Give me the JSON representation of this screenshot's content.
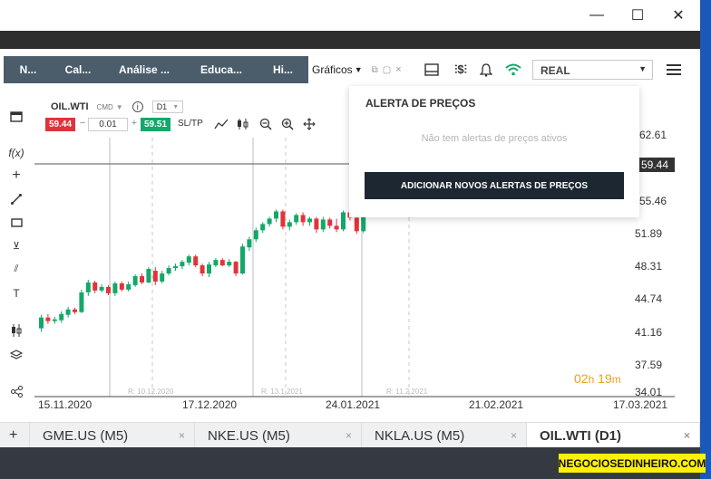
{
  "nav": {
    "tabs": [
      {
        "label": "N..."
      },
      {
        "label": "Cal..."
      },
      {
        "label": "Análise ..."
      },
      {
        "label": "Educa..."
      },
      {
        "label": "Hi..."
      }
    ],
    "graficos_label": "Gráficos",
    "account_selector": "REAL"
  },
  "window": {
    "minimize": "—",
    "maximize": "☐",
    "close": "✕"
  },
  "instrument": {
    "symbol": "OIL.WTI",
    "type": "CMD",
    "timeframe": "D1",
    "sell_price": "59.44",
    "quantity": "0.01",
    "buy_price": "59.51",
    "sltp_label": "SL/TP",
    "minus": "−",
    "plus": "+"
  },
  "price_alerts": {
    "title": "ALERTA DE PREÇOS",
    "empty_text": "Não tem alertas de preços ativos",
    "add_button": "ADICIONAR NOVOS ALERTAS DE PREÇOS"
  },
  "chart_data": {
    "type": "candlestick",
    "symbol": "OIL.WTI",
    "timeframe": "D1",
    "current_price": "59.44",
    "y_ticks": [
      "62.61",
      "55.46",
      "51.89",
      "48.31",
      "44.74",
      "41.16",
      "37.59",
      "34.01"
    ],
    "x_ticks": [
      "15.11.2020",
      "17.12.2020",
      "24.01.2021",
      "21.02.2021",
      "17.03.2021"
    ],
    "rollover_labels": [
      "R: 10.12.2020",
      "R: 13.1.2021",
      "R: 11.2.2021"
    ],
    "candles": [
      [
        41.0,
        42.2,
        40.6,
        42.5,
        "up"
      ],
      [
        42.2,
        41.8,
        41.5,
        42.6,
        "down"
      ],
      [
        41.8,
        42.0,
        41.5,
        42.3,
        "up"
      ],
      [
        41.9,
        42.6,
        41.6,
        42.9,
        "up"
      ],
      [
        42.5,
        43.1,
        42.2,
        43.4,
        "up"
      ],
      [
        43.1,
        42.8,
        42.6,
        43.3,
        "down"
      ],
      [
        42.8,
        45.0,
        42.7,
        45.3,
        "up"
      ],
      [
        45.0,
        46.1,
        44.6,
        46.4,
        "up"
      ],
      [
        46.1,
        45.2,
        44.9,
        46.3,
        "down"
      ],
      [
        45.2,
        45.6,
        45.0,
        45.9,
        "up"
      ],
      [
        45.6,
        44.9,
        44.7,
        45.8,
        "down"
      ],
      [
        44.9,
        46.0,
        44.6,
        46.2,
        "up"
      ],
      [
        46.0,
        45.3,
        45.1,
        46.2,
        "down"
      ],
      [
        45.3,
        45.9,
        45.1,
        46.2,
        "up"
      ],
      [
        45.8,
        46.8,
        45.6,
        47.0,
        "up"
      ],
      [
        46.8,
        46.1,
        45.9,
        47.1,
        "down"
      ],
      [
        46.1,
        47.6,
        46.0,
        47.8,
        "up"
      ],
      [
        47.4,
        46.2,
        45.8,
        47.8,
        "down"
      ],
      [
        46.2,
        47.1,
        46.0,
        47.4,
        "up"
      ],
      [
        47.1,
        47.7,
        46.9,
        48.0,
        "up"
      ],
      [
        47.7,
        47.9,
        47.4,
        48.2,
        "up"
      ],
      [
        47.9,
        48.4,
        47.6,
        48.6,
        "up"
      ],
      [
        48.3,
        49.0,
        48.0,
        49.2,
        "up"
      ],
      [
        49.0,
        48.0,
        47.8,
        49.2,
        "down"
      ],
      [
        48.0,
        47.1,
        46.8,
        48.2,
        "down"
      ],
      [
        47.1,
        48.1,
        46.7,
        48.4,
        "up"
      ],
      [
        48.0,
        48.6,
        47.8,
        48.8,
        "up"
      ],
      [
        48.6,
        48.0,
        47.9,
        48.8,
        "down"
      ],
      [
        48.0,
        48.4,
        47.8,
        48.7,
        "up"
      ],
      [
        48.4,
        47.1,
        46.8,
        48.5,
        "down"
      ],
      [
        47.1,
        50.1,
        47.0,
        50.4,
        "up"
      ],
      [
        50.0,
        50.9,
        49.6,
        51.2,
        "up"
      ],
      [
        50.9,
        51.9,
        50.6,
        52.2,
        "up"
      ],
      [
        51.9,
        52.6,
        51.6,
        52.8,
        "up"
      ],
      [
        52.6,
        53.2,
        52.3,
        53.4,
        "up"
      ],
      [
        53.2,
        54.0,
        52.8,
        54.2,
        "up"
      ],
      [
        54.0,
        52.3,
        52.0,
        54.2,
        "down"
      ],
      [
        52.3,
        52.8,
        51.9,
        53.1,
        "up"
      ],
      [
        52.8,
        53.6,
        52.5,
        53.8,
        "up"
      ],
      [
        53.6,
        52.8,
        52.4,
        53.9,
        "down"
      ],
      [
        52.8,
        53.2,
        52.4,
        53.4,
        "up"
      ],
      [
        53.2,
        52.0,
        51.6,
        53.4,
        "down"
      ],
      [
        52.0,
        53.1,
        51.7,
        53.4,
        "up"
      ],
      [
        53.1,
        52.4,
        52.1,
        53.3,
        "down"
      ],
      [
        52.4,
        52.0,
        51.7,
        53.2,
        "down"
      ],
      [
        52.0,
        53.9,
        51.8,
        54.1,
        "up"
      ],
      [
        53.9,
        53.3,
        53.0,
        54.2,
        "down"
      ],
      [
        53.3,
        51.8,
        51.5,
        53.5,
        "down"
      ],
      [
        51.8,
        54.6,
        51.6,
        54.9,
        "up"
      ]
    ]
  },
  "countdown": {
    "h": "02",
    "h_unit": "h",
    "m": "19",
    "m_unit": "m"
  },
  "bottom_tabs": [
    {
      "label": "+"
    },
    {
      "label": "GME.US (M5)"
    },
    {
      "label": "NKE.US (M5)"
    },
    {
      "label": "NKLA.US (M5)"
    },
    {
      "label": "OIL.WTI (D1)"
    }
  ],
  "close_glyph": "×",
  "watermark": "NEGOCIOSEDINHEIRO.COM",
  "colors": {
    "up": "#13a86a",
    "down": "#e1343a",
    "nav_bg": "#4b5d6b"
  }
}
